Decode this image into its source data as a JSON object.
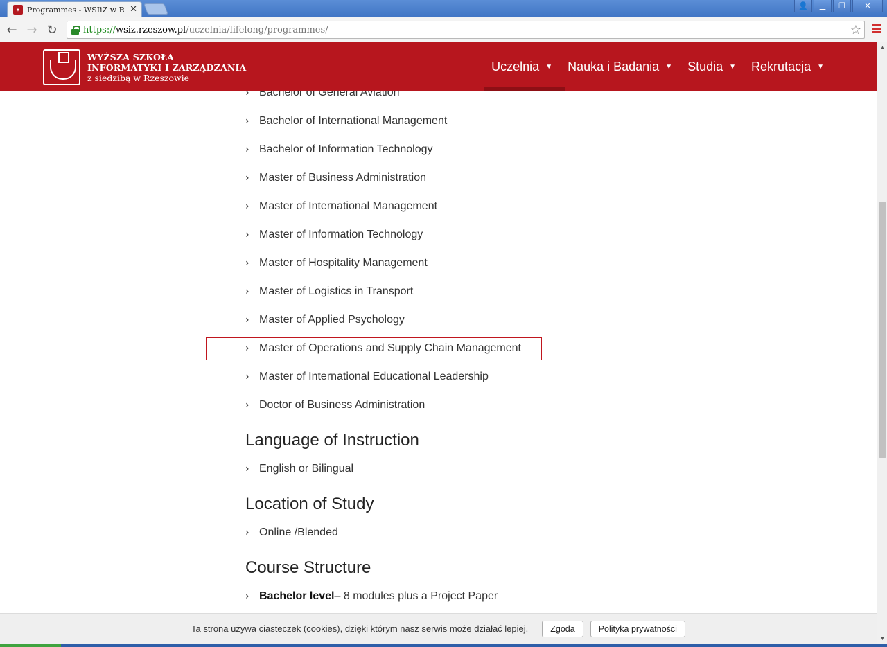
{
  "browser": {
    "tab_title": "Programmes - WSIiZ w Rzes",
    "url_scheme": "https://",
    "url_host": "wsiz.rzeszow.pl",
    "url_path": "/uczelnia/lifelong/programmes/"
  },
  "header": {
    "logo_line1": "WYŻSZA SZKOŁA",
    "logo_line2": "INFORMATYKI I ZARZĄDZANIA",
    "logo_line3": "z siedzibą w Rzeszowie",
    "nav": [
      {
        "label": "Uczelnia"
      },
      {
        "label": "Nauka i Badania"
      },
      {
        "label": "Studia"
      },
      {
        "label": "Rekrutacja"
      }
    ]
  },
  "programmes": [
    "Bachelor of General Aviation",
    "Bachelor of International Management",
    "Bachelor of Information Technology",
    "Master of Business Administration",
    "Master of International Management",
    "Master of Information Technology",
    "Master of Hospitality Management",
    "Master of Logistics in Transport",
    "Master of Applied Psychology",
    "Master of Operations and Supply Chain Management",
    "Master of International Educational Leadership",
    "Doctor of Business Administration"
  ],
  "language": {
    "heading": "Language of Instruction",
    "items": [
      "English or Bilingual"
    ]
  },
  "location": {
    "heading": "Location of Study",
    "items": [
      "Online /Blended"
    ]
  },
  "structure": {
    "heading": "Course Structure",
    "item_bold": "Bachelor level",
    "item_rest": " – 8 modules plus a Project Paper"
  },
  "cookie": {
    "text": "Ta strona używa ciasteczek (cookies), dzięki którym nasz serwis może działać lepiej.",
    "accept_label": "Zgoda",
    "policy_label": "Polityka prywatności"
  }
}
